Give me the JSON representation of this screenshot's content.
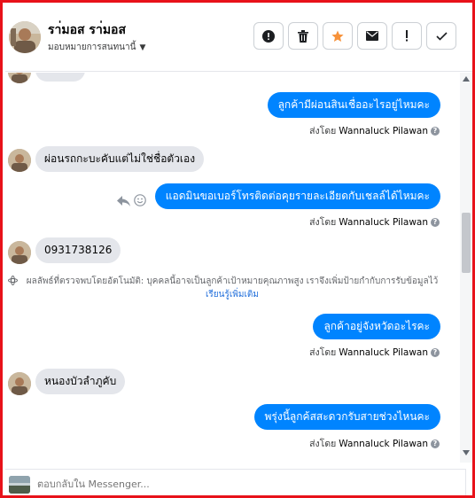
{
  "header": {
    "contact_name": "รา่มอส รา่มอส",
    "assign_label": "มอบหมายการสนทนานี้",
    "actions": [
      {
        "name": "report-button",
        "icon": "alert-circle-icon"
      },
      {
        "name": "delete-button",
        "icon": "trash-icon"
      },
      {
        "name": "star-button",
        "icon": "star-icon"
      },
      {
        "name": "mark-unread-button",
        "icon": "envelope-icon"
      },
      {
        "name": "spam-button",
        "icon": "exclamation-icon"
      },
      {
        "name": "mark-done-button",
        "icon": "check-icon"
      }
    ]
  },
  "messages": {
    "m1": "ลูกค้ามีผ่อนสินเชื่ออะไรอยู่ไหมคะ",
    "m2": "ผ่อนรถกะบะคับแต่ไม่ใช่ชื่อตัวเอง",
    "m3": "แอดมินขอเบอร์โทรติดต่อคุยรายละเอียดกับเชลล์ได้ไหมคะ",
    "m4": "0931738126",
    "m5": "ลูกค้าอยู่จังหวัดอะไรคะ",
    "m6": "หนองบัวลำภูคับ",
    "m7": "พรุ่งนี้ลูกค้สสะดวกรับสายช่วงไหนคะ"
  },
  "sent_by": {
    "label": "ส่งโดย",
    "name": "Wannaluck Pilawan",
    "help": "?"
  },
  "notice": {
    "text": "ผลลัพธ์ที่ตรวจพบโดยอัตโนมัติ: บุคคลนี้อาจเป็นลูกค้าเป้าหมายคุณภาพสูง เราจึงเพิ่มป้ายกำกับการรับข้อมูลไว้",
    "link": "เรียนรู้เพิ่มเติม"
  },
  "composer": {
    "placeholder": "ตอบกลับใน Messenger..."
  },
  "colors": {
    "frame_border": "#e8121a",
    "outgoing_bubble": "#0084ff",
    "incoming_bubble": "#e4e6eb",
    "star": "#f7923a"
  }
}
